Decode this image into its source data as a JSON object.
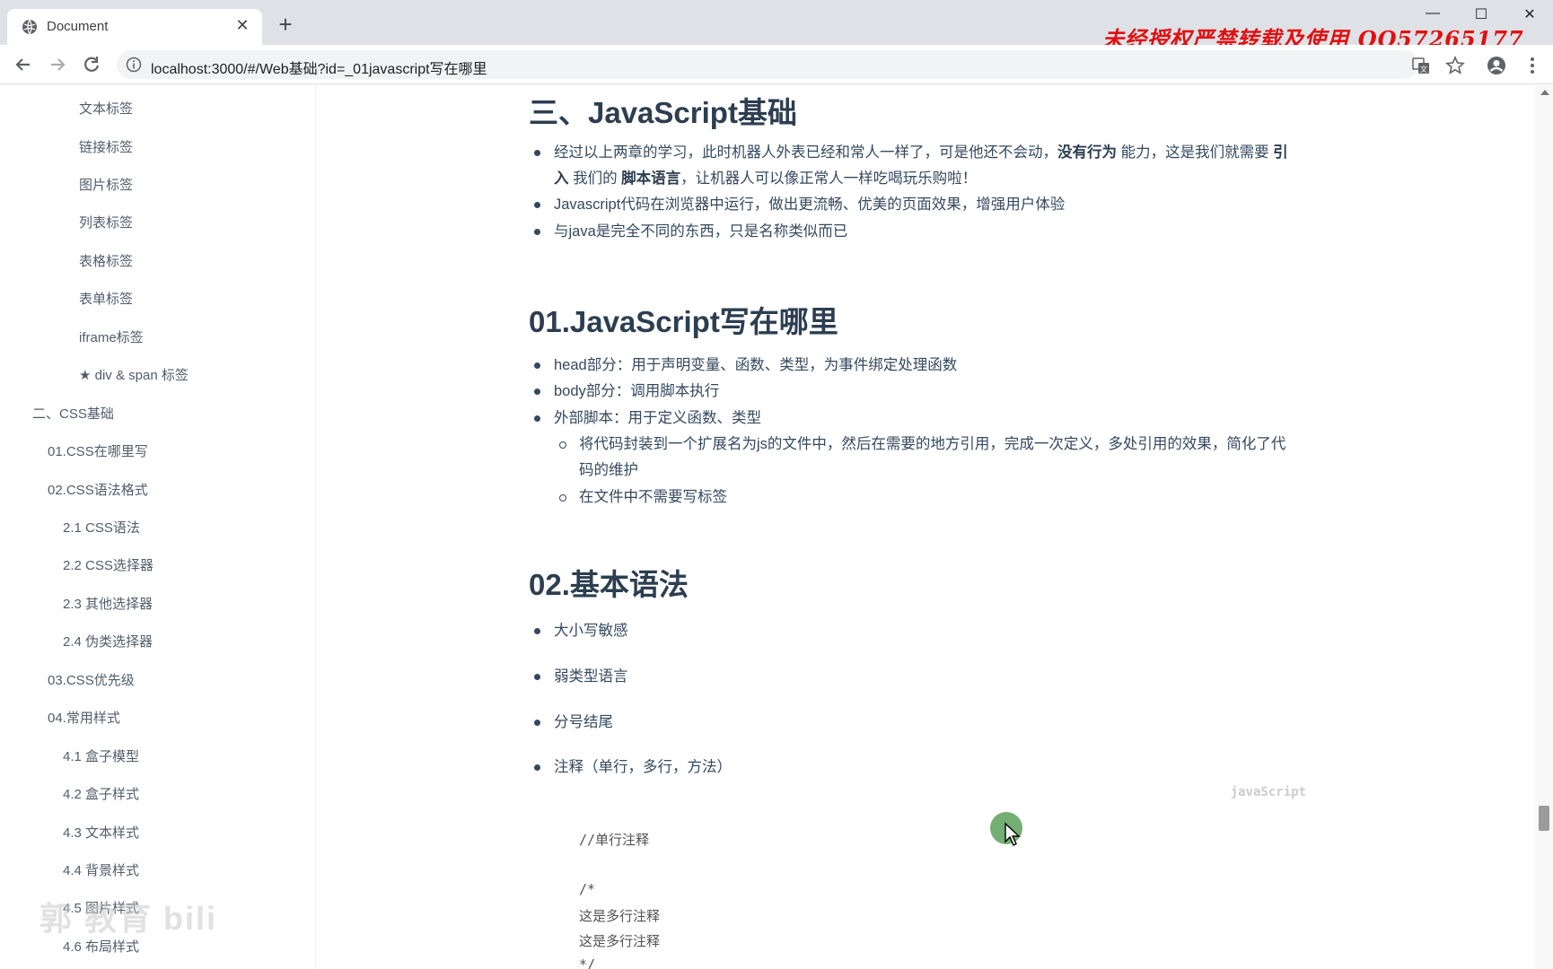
{
  "browser": {
    "tab_title": "Document",
    "tab_close": "✕",
    "new_tab": "+",
    "url": "localhost:3000/#/Web基础?id=_01javascript写在哪里",
    "watermark": "未经授权严禁转载及使用 QQ57265177",
    "window_controls": {
      "minimize": "—",
      "maximize": "☐",
      "close": "✕"
    }
  },
  "sidebar": {
    "items": [
      "文本标签",
      "链接标签",
      "图片标签",
      "列表标签",
      "表格标签",
      "表单标签",
      "iframe标签",
      "★ div & span 标签",
      "二、CSS基础",
      "01.CSS在哪里写",
      "02.CSS语法格式",
      "2.1 CSS语法",
      "2.2 CSS选择器",
      "2.3 其他选择器",
      "2.4 伪类选择器",
      "03.CSS优先级",
      "04.常用样式",
      "4.1 盒子模型",
      "4.2 盒子样式",
      "4.3 文本样式",
      "4.4 背景样式",
      "4.5 图片样式",
      "4.6 布局样式"
    ],
    "watermark": "郭 教育 bili"
  },
  "content": {
    "section_title": "三、JavaScript基础",
    "intro": {
      "b1_part1": "经过以上两章的学习，此时机器人外表已经和常人一样了，可是他还不会动，",
      "b1_bold1": "没有行为",
      "b1_part2": " 能力，这是我们就需要 ",
      "b1_bold2": "引",
      "b1_bold3": "入",
      "b1_part3": " 我们的 ",
      "b1_bold4": "脚本语言",
      "b1_part4": "，让机器人可以像正常人一样吃喝玩乐购啦！",
      "b2": "Javascript代码在浏览器中运行，做出更流畅、优美的页面效果，增强用户体验",
      "b3": "与java是完全不同的东西，只是名称类似而已"
    },
    "where": {
      "title": "01.JavaScript写在哪里",
      "b1": "head部分：用于声明变量、函数、类型，为事件绑定处理函数",
      "b2": "body部分：调用脚本执行",
      "b3": "外部脚本：用于定义函数、类型",
      "sub1_line1": "将代码封装到一个扩展名为js的文件中，然后在需要的地方引用，完成一次定义，多处引用的效果，简化了代",
      "sub1_line2": "码的维护",
      "sub2": "在文件中不需要写标签"
    },
    "syntax": {
      "title": "02.基本语法",
      "items": [
        "大小写敏感",
        "弱类型语言",
        "分号结尾",
        "注释（单行，多行，方法）"
      ]
    },
    "code": {
      "lang": "javaScript",
      "lines": [
        "//单行注释",
        "/*",
        "  这是多行注释",
        "  这是多行注释",
        "*/"
      ]
    }
  }
}
